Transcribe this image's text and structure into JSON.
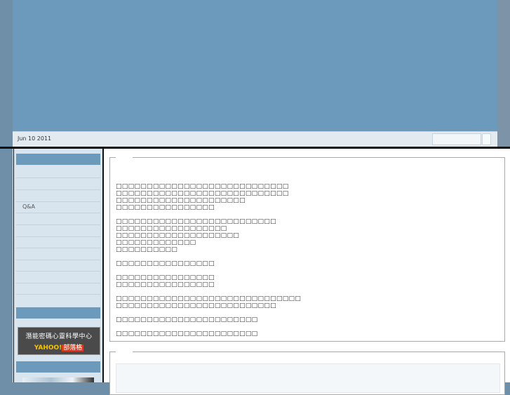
{
  "header": {
    "date": "Jun 10 2011",
    "search_placeholder": ""
  },
  "sidebar": {
    "items": [
      "",
      "",
      "",
      "Q&A",
      "",
      "",
      "",
      "",
      "",
      "",
      ""
    ],
    "badge": {
      "line1": "潛能密碼心靈科學中心",
      "yahoo": "YAHOO!",
      "blog": "部落格"
    }
  },
  "article": {
    "text": "□□□□□□□□□□□□□□□□□□□□□□□□□□□□\n□□□□□□□□□□□□□□□□□□□□□□□□□□□□\n□□□□□□□□□□□□□□□□□□□□□\n□□□□□□□□□□□□□□□□\n\n□□□□□□□□□□□□□□□□□□□□□□□□□□\n□□□□□□□□□□□□□□□□□□\n□□□□□□□□□□□□□□□□□□□□\n□□□□□□□□□□□□□\n□□□□□□□□□□\n\n□□□□□□□□□□□□□□□□\n\n□□□□□□□□□□□□□□□□\n□□□□□□□□□□□□□□□□\n\n□□□□□□□□□□□□□□□□□□□□□□□□□□□□□□\n□□□□□□□□□□□□□□□□□□□□□□□□□□\n\n□□□□□□□□□□□□□□□□□□□□□□□\n\n□□□□□□□□□□□□□□□□□□□□□□□"
  },
  "colors": {
    "banner": "#6b9abd",
    "sidebar": "#d9e5ee",
    "badge_yellow": "#f5c400"
  }
}
